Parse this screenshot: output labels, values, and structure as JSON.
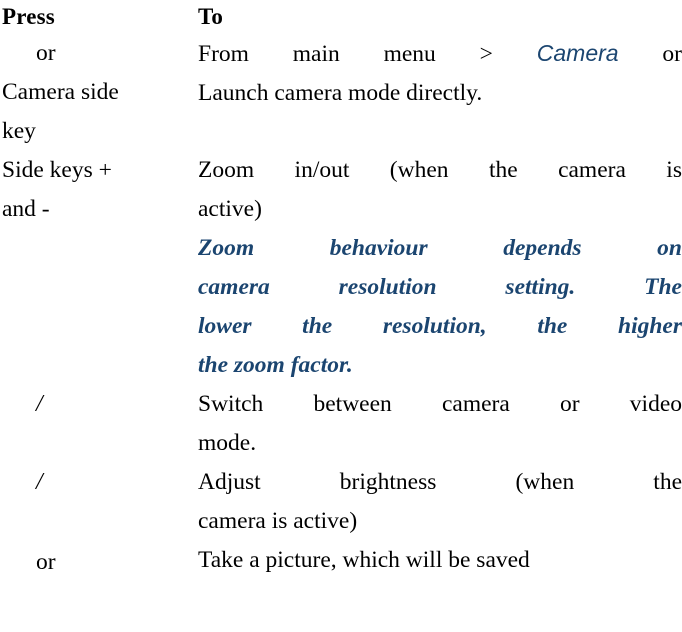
{
  "document": {
    "type": "reference-table",
    "title_columns": {
      "press": "Press",
      "to": "To"
    },
    "accent_color": "#1b4570",
    "text_color": "#000000",
    "background_color": "#ffffff"
  },
  "table": {
    "headers": {
      "col1": "Press",
      "col2": "To"
    },
    "rows": [
      {
        "press_lines": [
          "or",
          "Camera side",
          "key"
        ],
        "to_lines": [
          {
            "segments": [
              {
                "text": "From  main  menu  >  ",
                "style": "normal"
              },
              {
                "text": "Camera",
                "style": "accent-sans-italic"
              },
              {
                "text": "  or",
                "style": "normal"
              }
            ]
          },
          {
            "segments": [
              {
                "text": "Launch camera mode directly.",
                "style": "normal"
              }
            ]
          }
        ]
      },
      {
        "press_lines": [
          "Side keys +",
          "and -"
        ],
        "to_lines": [
          {
            "segments": [
              {
                "text": "Zoom  in/out  (when  the  camera  is",
                "style": "normal"
              }
            ]
          },
          {
            "segments": [
              {
                "text": "active)",
                "style": "normal"
              }
            ]
          }
        ],
        "to_note_lines": [
          "Zoom   behaviour   depends   on",
          "camera   resolution   setting.   The",
          "lower  the  resolution,  the  higher",
          "the zoom factor."
        ]
      },
      {
        "press_lines": [
          "/"
        ],
        "to_lines": [
          {
            "segments": [
              {
                "text": "Switch  between  camera  or  video",
                "style": "normal"
              }
            ]
          },
          {
            "segments": [
              {
                "text": "mode.",
                "style": "normal"
              }
            ]
          }
        ]
      },
      {
        "press_lines": [
          "/"
        ],
        "to_lines": [
          {
            "segments": [
              {
                "text": "Adjust    brightness    (when    the",
                "style": "normal"
              }
            ]
          },
          {
            "segments": [
              {
                "text": "camera is active)",
                "style": "normal"
              }
            ]
          }
        ]
      },
      {
        "press_lines": [
          "or"
        ],
        "to_lines": [
          {
            "segments": [
              {
                "text": "Take a picture, which will be saved",
                "style": "normal"
              }
            ]
          }
        ]
      }
    ]
  }
}
